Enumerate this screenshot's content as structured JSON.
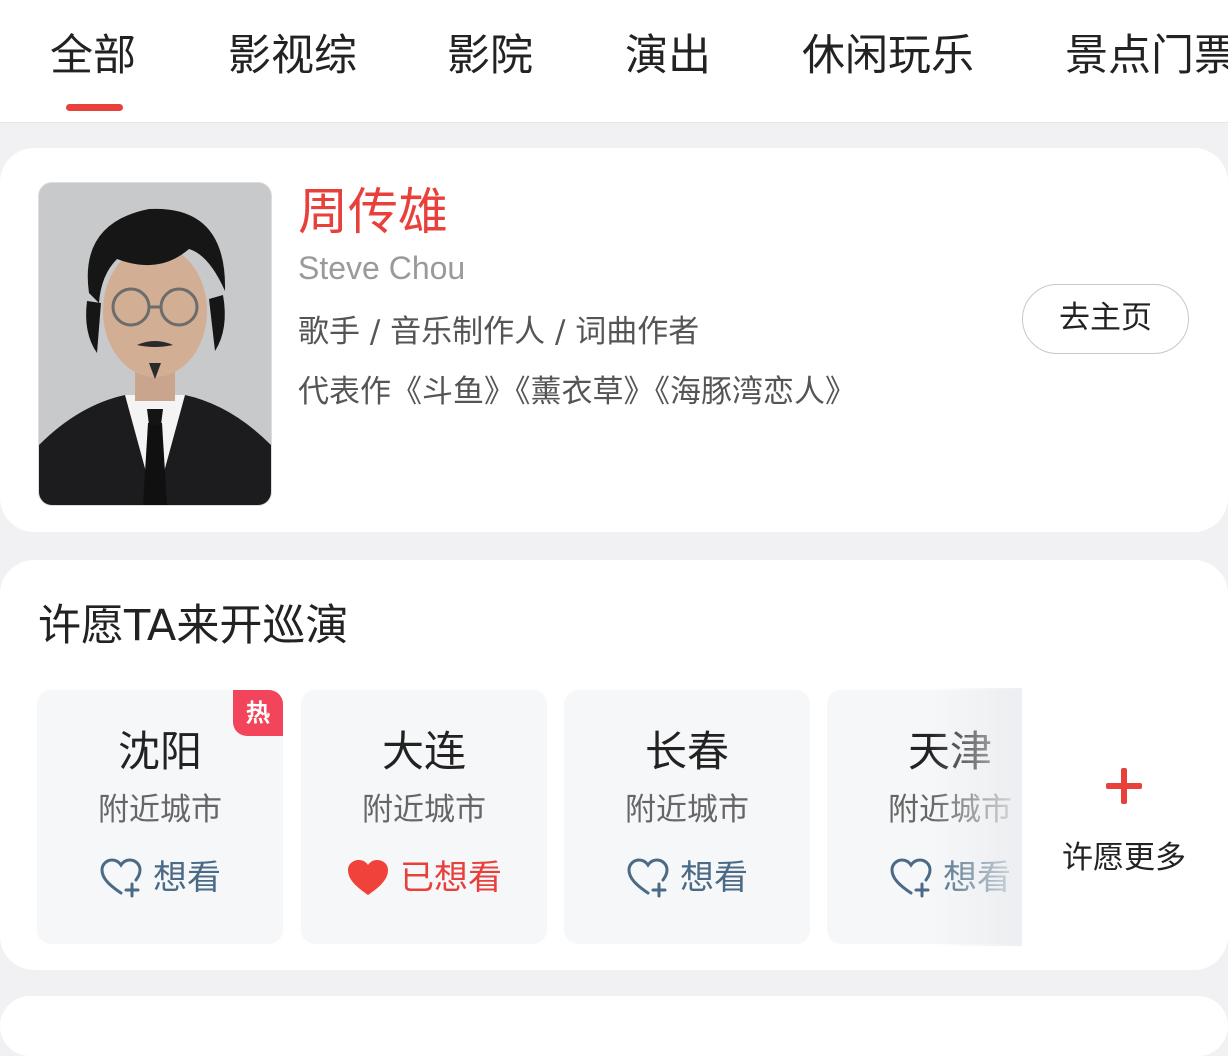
{
  "tabs": [
    {
      "label": "全部",
      "active": true
    },
    {
      "label": "影视综"
    },
    {
      "label": "影院"
    },
    {
      "label": "演出"
    },
    {
      "label": "休闲玩乐"
    },
    {
      "label": "景点门票"
    }
  ],
  "profile": {
    "name_cn": "周传雄",
    "name_en": "Steve Chou",
    "roles": "歌手 / 音乐制作人 / 词曲作者",
    "works": "代表作《斗鱼》《薰衣草》《海豚湾恋人》",
    "home_button": "去主页"
  },
  "wish": {
    "title": "许愿TA来开巡演",
    "cities": [
      {
        "name": "沈阳",
        "sub": "附近城市",
        "want": "想看",
        "hot_badge": "热"
      },
      {
        "name": "大连",
        "sub": "附近城市",
        "want": "已想看"
      },
      {
        "name": "长春",
        "sub": "附近城市",
        "want": "想看"
      },
      {
        "name": "天津",
        "sub": "附近城市",
        "want": "想看"
      }
    ],
    "more_label": "许愿更多"
  },
  "colors": {
    "accent": "#e8403b",
    "want_blue": "#4a6a85",
    "hot_badge": "#f2455b"
  }
}
